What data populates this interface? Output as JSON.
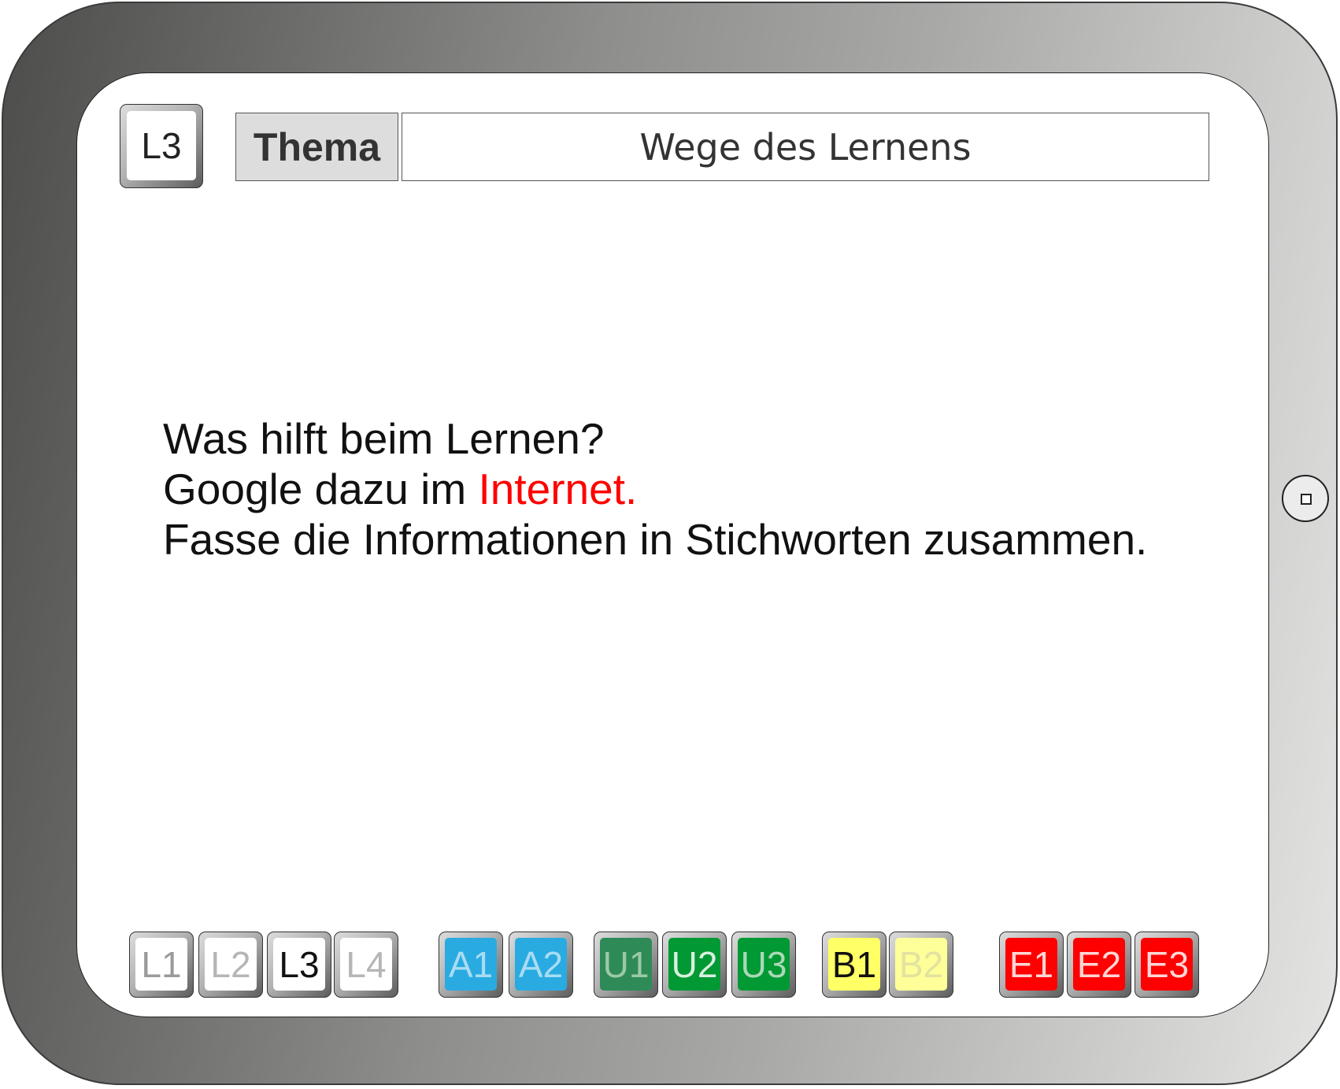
{
  "header": {
    "current_badge": "L3",
    "topic_label": "Thema",
    "topic_title": "Wege des Lernens"
  },
  "content": {
    "line1": "Was hilft beim Lernen?",
    "line2_prefix": "Google dazu im ",
    "line2_highlight": "Internet.",
    "line3": "Fasse die Informationen in Stichworten zusammen."
  },
  "nav": {
    "L": [
      "L1",
      "L2",
      "L3",
      "L4"
    ],
    "A": [
      "A1",
      "A2"
    ],
    "U": [
      "U1",
      "U2",
      "U3"
    ],
    "B": [
      "B1",
      "B2"
    ],
    "E": [
      "E1",
      "E2",
      "E3"
    ]
  },
  "colors": {
    "highlight": "#ff0000",
    "L_face": "#ffffff",
    "A_face": "#29abe2",
    "U_face": "#009933",
    "B_face": "#ffff66",
    "E_face": "#ff0000"
  }
}
